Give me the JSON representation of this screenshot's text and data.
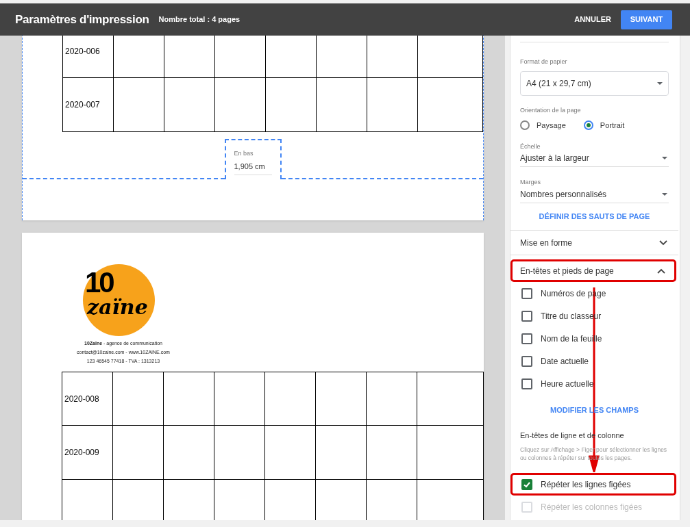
{
  "header": {
    "title": "Paramètres d'impression",
    "subtitle": "Nombre total : 4 pages",
    "cancel": "ANNULER",
    "next": "SUIVANT"
  },
  "preview": {
    "page1_rows": [
      "2020-006",
      "2020-007"
    ],
    "margin_field": {
      "label": "En bas",
      "value": "1,905 cm"
    },
    "logo": {
      "line1": "10",
      "line2": "zaïne"
    },
    "company_lines": [
      "**10Zaïne** - agence de communication",
      "contact@10zaine.com - www.10ZAINE.com",
      "123 46545 77418 - TVA : 1313213"
    ],
    "page2_rows": [
      "2020-008",
      "2020-009"
    ]
  },
  "settings": {
    "paper_format": {
      "label": "Format de papier",
      "value": "A4 (21 x 29,7 cm)"
    },
    "orientation": {
      "label": "Orientation de la page",
      "options": [
        {
          "label": "Paysage",
          "selected": false
        },
        {
          "label": "Portrait",
          "selected": true
        }
      ]
    },
    "scale": {
      "label": "Échelle",
      "value": "Ajuster à la largeur"
    },
    "margins": {
      "label": "Marges",
      "value": "Nombres personnalisés"
    },
    "page_breaks_link": "DÉFINIR DES SAUTS DE PAGE",
    "formatting": {
      "title": "Mise en forme",
      "expanded": false
    },
    "headers_footers": {
      "title": "En-têtes et pieds de page",
      "expanded": true,
      "options": [
        {
          "label": "Numéros de page",
          "checked": false
        },
        {
          "label": "Titre du classeur",
          "checked": false
        },
        {
          "label": "Nom de la feuille",
          "checked": false
        },
        {
          "label": "Date actuelle",
          "checked": false
        },
        {
          "label": "Heure actuelle",
          "checked": false
        }
      ],
      "link": "MODIFIER LES CHAMPS"
    },
    "row_col_headers": {
      "title": "En-têtes de ligne et de colonne",
      "hint": "Cliquez sur Affichage > Figer pour sélectionner les lignes ou colonnes à répéter sur toutes les pages.",
      "options": [
        {
          "label": "Répéter les lignes figées",
          "checked": true,
          "disabled": false
        },
        {
          "label": "Répéter les colonnes figées",
          "checked": false,
          "disabled": true
        }
      ]
    }
  }
}
